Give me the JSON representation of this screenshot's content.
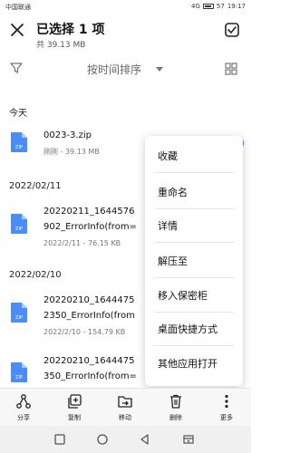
{
  "status": {
    "carrier": "中国联通",
    "signal": "4G",
    "battery": "57",
    "time": "19:17"
  },
  "header": {
    "title": "已选择 1 项",
    "subtitle": "共 39.13 MB"
  },
  "toolbar": {
    "sort_label": "按时间排序"
  },
  "sections": [
    {
      "label": "今天"
    },
    {
      "label": "2022/02/11"
    },
    {
      "label": "2022/02/10"
    }
  ],
  "files": [
    {
      "name": "0023-3.zip",
      "meta": "刚刚 - 39.13 MB",
      "icon": "zip-icon",
      "selected": true
    },
    {
      "name_line1": "20220211_1644576",
      "name_line2": "902_ErrorInfo(from=",
      "meta": "2022/2/11 - 76.15 KB",
      "icon": "zip-icon"
    },
    {
      "name_line1": "20220210_1644475",
      "name_line2": "2350_ErrorInfo(from",
      "meta": "2022/2/10 - 154.79 KB",
      "icon": "zip-icon"
    },
    {
      "name_line1": "20220210_1644475",
      "name_line2": "350_ErrorInfo(from=",
      "icon": "zip-icon"
    }
  ],
  "menu": {
    "items": [
      "收藏",
      "重命名",
      "详情",
      "解压至",
      "移入保密柜",
      "桌面快捷方式",
      "其他应用打开"
    ]
  },
  "bottom_bar": {
    "share": "分享",
    "copy": "复制",
    "move": "移动",
    "delete": "删除",
    "more": "更多"
  },
  "colors": {
    "accent": "#2f7df6",
    "zip_icon": "#4a8df6"
  }
}
